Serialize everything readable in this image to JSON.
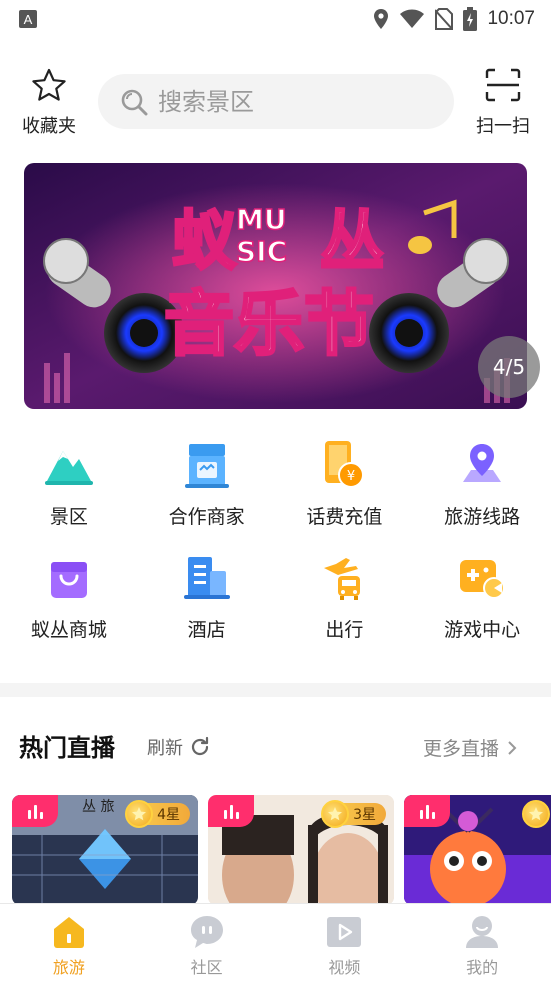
{
  "status_bar": {
    "time": "10:07",
    "left_icon": "A"
  },
  "header": {
    "favorites_label": "收藏夹",
    "search_placeholder": "搜索景区",
    "scan_label": "扫一扫"
  },
  "banner": {
    "title_line1_left": "蚁",
    "title_music_top": "MU",
    "title_music_bottom": "SIC",
    "title_line1_right": "丛",
    "title_line2": "音乐节",
    "counter": "4/5",
    "colors": {
      "bg": "#3a1a5e",
      "accent": "#ff2e6d"
    }
  },
  "categories": [
    {
      "label": "景区",
      "icon": "mountain-icon"
    },
    {
      "label": "合作商家",
      "icon": "shop-icon"
    },
    {
      "label": "话费充值",
      "icon": "phone-recharge-icon"
    },
    {
      "label": "旅游线路",
      "icon": "map-route-icon"
    },
    {
      "label": "蚁丛商城",
      "icon": "shopping-bag-icon"
    },
    {
      "label": "酒店",
      "icon": "hotel-icon"
    },
    {
      "label": "出行",
      "icon": "travel-icon"
    },
    {
      "label": "游戏中心",
      "icon": "gamepad-icon"
    }
  ],
  "live": {
    "title": "热门直播",
    "refresh_label": "刷新",
    "more_label": "更多直播",
    "cards": [
      {
        "stars": "4星",
        "top_text": "丛  旅"
      },
      {
        "stars": "3星"
      },
      {
        "stars": ""
      }
    ]
  },
  "bottom_nav": [
    {
      "label": "旅游",
      "icon": "travel-home-icon",
      "active": true
    },
    {
      "label": "社区",
      "icon": "community-icon",
      "active": false
    },
    {
      "label": "视频",
      "icon": "video-icon",
      "active": false
    },
    {
      "label": "我的",
      "icon": "profile-icon",
      "active": false
    }
  ],
  "colors": {
    "accent": "#f0a020",
    "live_tag": "#ff2e6d"
  }
}
